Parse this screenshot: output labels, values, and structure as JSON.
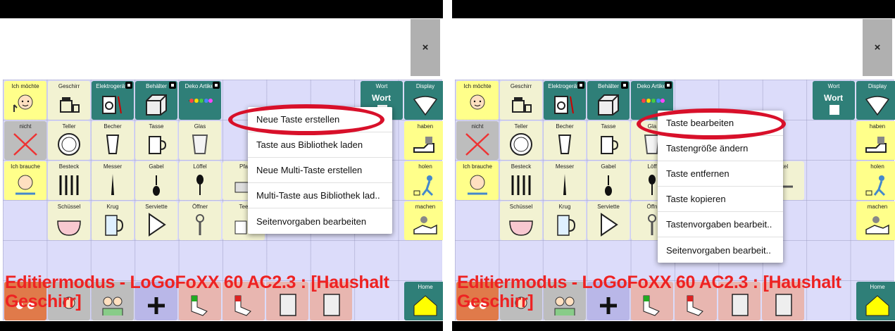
{
  "close_label": "×",
  "colors": {
    "accent_red": "#ee2222",
    "oval": "#d8102a",
    "grid_bg": "#dcdcfa",
    "teal": "#2f7f78",
    "yellow": "#ffff8a"
  },
  "left": {
    "keys": [
      {
        "label": "Ich möchte",
        "icon": "person-icon"
      },
      {
        "label": "Geschirr",
        "icon": "dishes-icon"
      },
      {
        "label": "Elektrogeräte",
        "icon": "appliance-icon"
      },
      {
        "label": "Behälter",
        "icon": "box-icon"
      },
      {
        "label": "Deko Artikel",
        "icon": "decoration-icon"
      },
      {
        "label": "Wort",
        "icon": "word-icon"
      },
      {
        "label": "Display",
        "icon": "display-icon"
      },
      {
        "label": "nicht",
        "icon": "cross-icon"
      },
      {
        "label": "Teller",
        "icon": "plate-icon"
      },
      {
        "label": "Becher",
        "icon": "cup-icon"
      },
      {
        "label": "Tasse",
        "icon": "mug-icon"
      },
      {
        "label": "Glas",
        "icon": "glass-icon"
      },
      {
        "label": "haben",
        "icon": "hand-icon"
      },
      {
        "label": "Ich brauche",
        "icon": "person-icon"
      },
      {
        "label": "Besteck",
        "icon": "cutlery-icon"
      },
      {
        "label": "Messer",
        "icon": "knife-icon"
      },
      {
        "label": "Gabel",
        "icon": "fork-icon"
      },
      {
        "label": "Löffel",
        "icon": "spoon-icon"
      },
      {
        "label": "Pfa",
        "icon": "pan-icon"
      },
      {
        "label": "holen",
        "icon": "fetch-icon"
      },
      {
        "label": "Schüssel",
        "icon": "bowl-icon"
      },
      {
        "label": "Krug",
        "icon": "jug-icon"
      },
      {
        "label": "Serviette",
        "icon": "napkin-icon"
      },
      {
        "label": "Öffner",
        "icon": "opener-icon"
      },
      {
        "label": "Tee",
        "icon": "tea-icon"
      },
      {
        "label": "machen",
        "icon": "make-icon"
      },
      {
        "label": "Home",
        "icon": "home-icon"
      }
    ],
    "menu": [
      "Neue Taste erstellen",
      "Taste aus Bibliothek laden",
      "Neue Multi-Taste erstellen",
      "Multi-Taste aus Bibliothek lad..",
      "Seitenvorgaben bearbeiten"
    ],
    "status_line1": "Editiermodus - LoGoFoXX 60 AC2.3 : [Haushalt",
    "status_line2": "Geschirr]"
  },
  "right": {
    "keys": [
      {
        "label": "Ich möchte",
        "icon": "person-icon"
      },
      {
        "label": "Geschirr",
        "icon": "dishes-icon"
      },
      {
        "label": "Elektrogeräte",
        "icon": "appliance-icon"
      },
      {
        "label": "Behälter",
        "icon": "box-icon"
      },
      {
        "label": "Deko Artikel",
        "icon": "decoration-icon"
      },
      {
        "label": "Wort",
        "icon": "word-icon"
      },
      {
        "label": "Display",
        "icon": "display-icon"
      },
      {
        "label": "nicht",
        "icon": "cross-icon"
      },
      {
        "label": "Teller",
        "icon": "plate-icon"
      },
      {
        "label": "Becher",
        "icon": "cup-icon"
      },
      {
        "label": "Tasse",
        "icon": "mug-icon"
      },
      {
        "label": "Gla",
        "icon": "glass-icon"
      },
      {
        "label": "haben",
        "icon": "hand-icon"
      },
      {
        "label": "Ich brauche",
        "icon": "person-icon"
      },
      {
        "label": "Besteck",
        "icon": "cutlery-icon"
      },
      {
        "label": "Messer",
        "icon": "knife-icon"
      },
      {
        "label": "Gabel",
        "icon": "fork-icon"
      },
      {
        "label": "Löff",
        "icon": "spoon-icon"
      },
      {
        "label": "ckel",
        "icon": "lid-icon"
      },
      {
        "label": "holen",
        "icon": "fetch-icon"
      },
      {
        "label": "Schüssel",
        "icon": "bowl-icon"
      },
      {
        "label": "Krug",
        "icon": "jug-icon"
      },
      {
        "label": "Serviette",
        "icon": "napkin-icon"
      },
      {
        "label": "Öffn",
        "icon": "opener-icon"
      },
      {
        "label": "machen",
        "icon": "make-icon"
      },
      {
        "label": "Home",
        "icon": "home-icon"
      }
    ],
    "menu": [
      "Taste bearbeiten",
      "Tastengröße ändern",
      "Taste entfernen",
      "Taste kopieren",
      "Tastenvorgaben bearbeit..",
      "Seitenvorgaben bearbeit.."
    ],
    "status_line1": "Editiermodus - LoGoFoXX 60 AC2.3 : [Haushalt",
    "status_line2": "Geschirr]"
  }
}
